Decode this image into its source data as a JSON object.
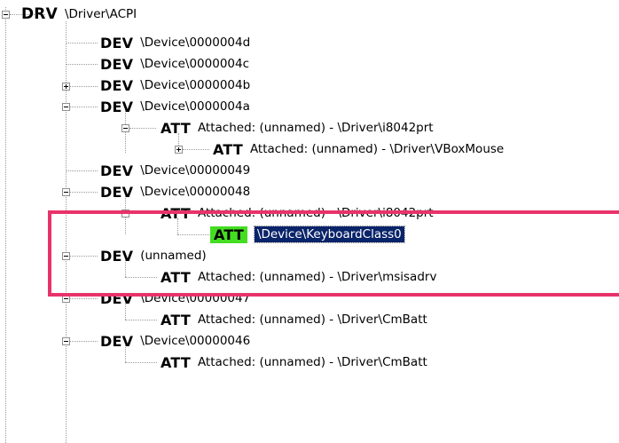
{
  "tree": {
    "root": {
      "type": "DRV",
      "path": "\\Driver\\ACPI"
    },
    "rows": [
      {
        "id": "dev-4d",
        "type": "DEV",
        "path": "\\Device\\0000004d"
      },
      {
        "id": "dev-4c",
        "type": "DEV",
        "path": "\\Device\\0000004c"
      },
      {
        "id": "dev-4b",
        "type": "DEV",
        "path": "\\Device\\0000004b",
        "expander": "plus"
      },
      {
        "id": "dev-4a",
        "type": "DEV",
        "path": "\\Device\\0000004a",
        "expander": "minus"
      },
      {
        "id": "att-i8042-a",
        "type": "ATT",
        "path": "Attached: (unnamed) - \\Driver\\i8042prt",
        "expander": "minus"
      },
      {
        "id": "att-vboxmouse",
        "type": "ATT",
        "path": "Attached: (unnamed) - \\Driver\\VBoxMouse",
        "expander": "plus"
      },
      {
        "id": "dev-49",
        "type": "DEV",
        "path": "\\Device\\00000049"
      },
      {
        "id": "dev-48",
        "type": "DEV",
        "path": "\\Device\\00000048",
        "expander": "minus"
      },
      {
        "id": "att-i8042-b",
        "type": "ATT",
        "path": "Attached: (unnamed) - \\Driver\\i8042prt",
        "expander": "minus"
      },
      {
        "id": "att-keyboard",
        "type": "ATT",
        "path": "\\Device\\KeyboardClass0",
        "selected": true
      },
      {
        "id": "dev-unnamed",
        "type": "DEV",
        "path": "(unnamed)",
        "expander": "minus"
      },
      {
        "id": "att-msisadrv",
        "type": "ATT",
        "path": "Attached: (unnamed) - \\Driver\\msisadrv"
      },
      {
        "id": "dev-47",
        "type": "DEV",
        "path": "\\Device\\00000047",
        "expander": "minus"
      },
      {
        "id": "att-cmbatt-a",
        "type": "ATT",
        "path": "Attached: (unnamed) - \\Driver\\CmBatt"
      },
      {
        "id": "dev-46",
        "type": "DEV",
        "path": "\\Device\\00000046",
        "expander": "minus"
      },
      {
        "id": "att-cmbatt-b",
        "type": "ATT",
        "path": "Attached: (unnamed) - \\Driver\\CmBatt"
      }
    ]
  },
  "colors": {
    "highlight_box": "#e8336a",
    "selected_tag_bg": "#44dd22",
    "selected_path_bg": "#0a246a"
  }
}
